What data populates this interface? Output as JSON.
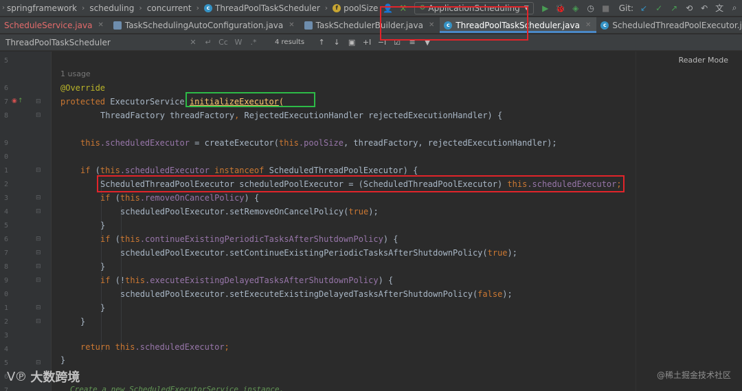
{
  "breadcrumb": [
    "springframework",
    "scheduling",
    "concurrent",
    "ThreadPoolTaskScheduler",
    "poolSize"
  ],
  "toolbar": {
    "run_config": "ApplicationScheduling",
    "git_label": "Git:"
  },
  "tabs": [
    {
      "label": "ScheduleService.java",
      "state": "error"
    },
    {
      "label": "TaskSchedulingAutoConfiguration.java",
      "state": "normal"
    },
    {
      "label": "TaskSchedulerBuilder.java",
      "state": "normal"
    },
    {
      "label": "ThreadPoolTaskScheduler.java",
      "state": "active"
    },
    {
      "label": "ScheduledThreadPoolExecutor.java",
      "state": "normal"
    }
  ],
  "search": {
    "value": "ThreadPoolTaskScheduler",
    "results": "4 results"
  },
  "reader_mode": "Reader Mode",
  "gutter": {
    "line_numbers": [
      "5",
      "6",
      "7",
      "8",
      "9",
      "0",
      "1",
      "2",
      "3",
      "4",
      "5",
      "6",
      "7",
      "8",
      "9",
      "0",
      "1",
      "2",
      "3",
      "4",
      "5",
      "6",
      "7"
    ]
  },
  "code": {
    "usage_hint": "1 usage",
    "annotation": "@Override",
    "kw_protected": "protected",
    "sig_type": " ExecutorService ",
    "method_name": "initializeExecutor",
    "paren_open": "(",
    "l2_param1_type": "ThreadFactory threadFactory",
    "l2_comma": ", ",
    "l2_param2": "RejectedExecutionHandler rejectedExecutionHandler) {",
    "kw_this": "this",
    "scheduledExecutor_field": ".scheduledExecutor",
    "assign_text": " = createExecutor(",
    "poolSize_field": ".poolSize",
    "assign_rest": ", threadFactory, rejectedExecutionHandler);",
    "kw_if": "if",
    "if_open": " (",
    "kw_instanceof": "instanceof",
    "if1_rest": " ScheduledThreadPoolExecutor) {",
    "cast_line": "ScheduledThreadPoolExecutor scheduledPoolExecutor = (ScheduledThreadPoolExecutor) ",
    "cast_end": ";",
    "removeOnCancelPolicy_field": ".removeOnCancelPolicy",
    "brace_open": ") {",
    "set_remove": "scheduledPoolExecutor.setRemoveOnCancelPolicy(",
    "kw_true": "true",
    "call_close": ");",
    "brace_close": "}",
    "continue_field": ".continueExistingPeriodicTasksAfterShutdownPolicy",
    "set_continue": "scheduledPoolExecutor.setContinueExistingPeriodicTasksAfterShutdownPolicy(",
    "if3_open": " (!",
    "execute_field": ".executeExistingDelayedTasksAfterShutdownPolicy",
    "set_execute": "scheduledPoolExecutor.setExecuteExistingDelayedTasksAfterShutdownPolicy(",
    "kw_false": "false",
    "kw_return": "return",
    "return_sp": " ",
    "bottom_hint": "Create a new ScheduledExecutorService instance."
  },
  "watermarks": {
    "left_brand": "大数跨境",
    "left_mark": "ᐯ℗",
    "right": "@稀土掘金技术社区"
  },
  "colors": {
    "keyword": "#cc7832",
    "field": "#9876aa",
    "method": "#ffc66d",
    "annotation": "#bbb529",
    "highlight_red": "#e2242a",
    "highlight_green": "#2dbb47",
    "active_tab_underline": "#4a88c7"
  }
}
